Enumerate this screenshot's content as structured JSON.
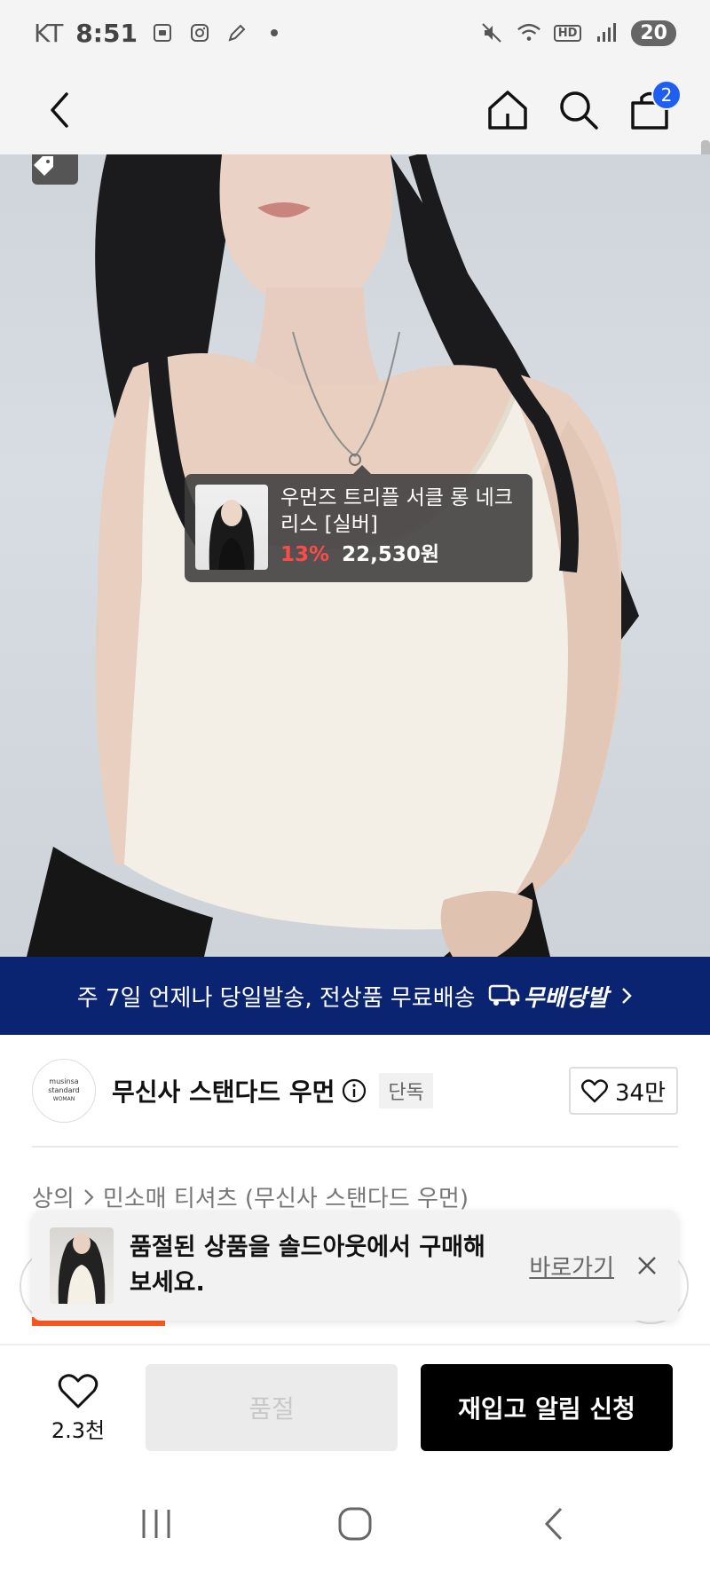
{
  "status_bar": {
    "carrier": "KT",
    "time": "8:51",
    "battery": "20"
  },
  "header": {
    "cart_count": "2"
  },
  "hero": {
    "tooltip": {
      "name": "우먼즈 트리플 서클 롱 네크리스 [실버]",
      "discount": "13%",
      "price": "22,530원"
    }
  },
  "banner": {
    "text": "주 7일 언제나 당일발송, 전상품 무료배송",
    "logo_label": "무배당발",
    "accent": "#0a2472"
  },
  "brand": {
    "logo_line1": "musinsa",
    "logo_line2": "standard",
    "logo_line3": "WOMAN",
    "name": "무신사 스탠다드 우먼",
    "badge": "단독",
    "likes": "34만"
  },
  "breadcrumb": {
    "category": "상의",
    "subcategory": "민소매 티셔츠 (무신사 스탠다드 우먼)"
  },
  "toast": {
    "message": "품절된 상품을 솔드아웃에서 구매해보세요.",
    "link_label": "바로가기"
  },
  "action_bar": {
    "wish_count": "2.3천",
    "soldout_label": "품절",
    "restock_label": "재입고 알림 신청"
  },
  "colors": {
    "discount": "#ff4a4a",
    "cart_badge": "#1e5ef0",
    "orange_tab": "#ff5a1f"
  },
  "icons": [
    "back-icon",
    "home-icon",
    "search-icon",
    "cart-icon",
    "tag-icon",
    "info-icon",
    "heart-icon",
    "close-icon",
    "truck-icon",
    "chevron-right-icon",
    "recent-apps-icon",
    "home-nav-icon",
    "back-nav-icon"
  ]
}
